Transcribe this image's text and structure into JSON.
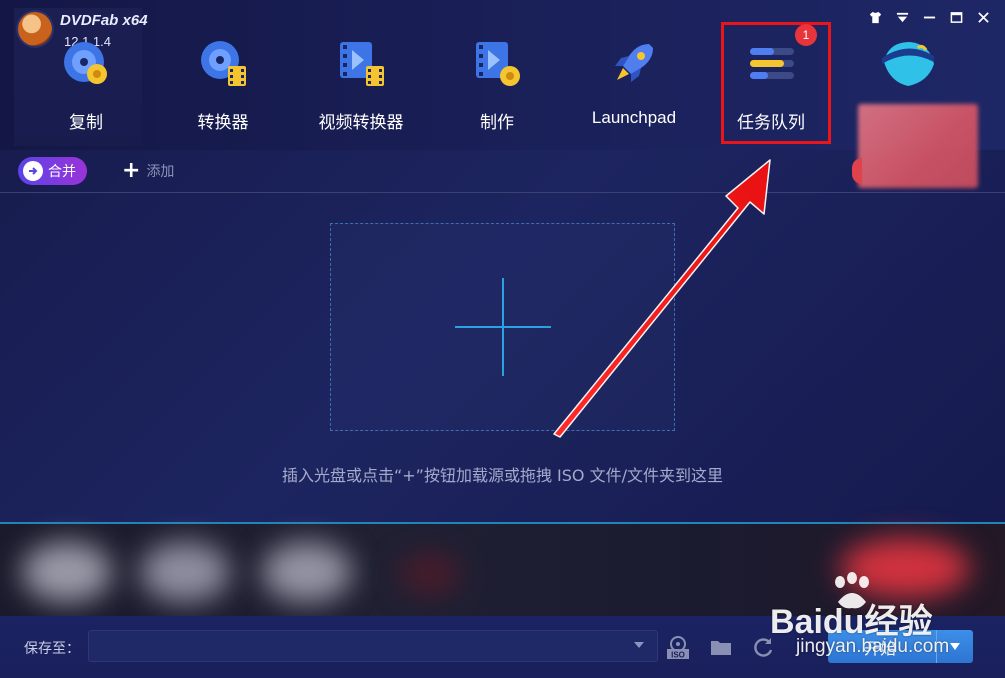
{
  "app": {
    "name": "DVDFab x64",
    "version": "12.1.1.4"
  },
  "window_controls": [
    {
      "name": "skin",
      "icon": "tshirt-icon"
    },
    {
      "name": "menu",
      "icon": "dropdown-menu-icon"
    },
    {
      "name": "minimize",
      "icon": "minimize-icon"
    },
    {
      "name": "maximize",
      "icon": "maximize-icon"
    },
    {
      "name": "close",
      "icon": "close-icon"
    }
  ],
  "nav": [
    {
      "label": "复制",
      "icon": "disc-copy-icon"
    },
    {
      "label": "转换器",
      "icon": "disc-converter-icon"
    },
    {
      "label": "视频转换器",
      "icon": "video-converter-icon"
    },
    {
      "label": "制作",
      "icon": "video-creator-icon"
    },
    {
      "label": "Launchpad",
      "icon": "rocket-icon"
    },
    {
      "label": "任务队列",
      "icon": "task-queue-icon",
      "badge": "1",
      "highlighted": true
    }
  ],
  "toolbar": {
    "merge_label": "合并",
    "add_label": "添加"
  },
  "drop_zone": {
    "hint": "插入光盘或点击“+”按钮加载源或拖拽 ISO 文件/文件夹到这里"
  },
  "footer": {
    "save_label": "保存至：",
    "save_path": "",
    "start_label": "开始"
  },
  "watermark": {
    "brand": "Baidu经验",
    "url": "jingyan.baidu.com"
  },
  "colors": {
    "accent_blue": "#2d75d2",
    "highlight_red": "#e8161b",
    "badge_red": "#e8353b",
    "merge_gradient_start": "#5b43e8",
    "merge_gradient_end": "#9a33d8",
    "separator_cyan": "#1e86b8"
  }
}
